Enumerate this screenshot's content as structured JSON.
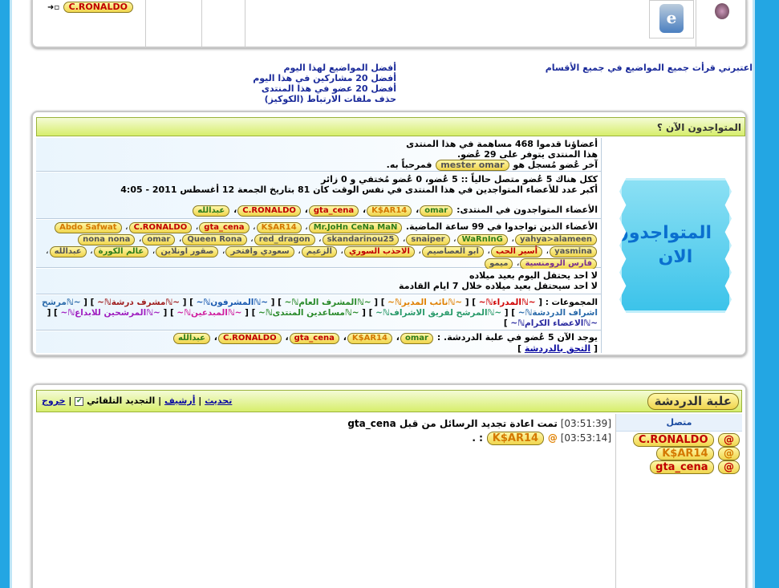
{
  "top": {
    "user_pill": "C.RONALDO"
  },
  "links": {
    "right": "اعتبرني قرأت جميع المواضيع في جميع الأقسام",
    "left": [
      "أفضل المواضيع لهذا اليوم",
      "أفضل 20 مشاركين في هذا اليوم",
      "أفضل 20 عضو في هذا المنتدى",
      "حذف ملفات الارتباط (الكوكيز)"
    ]
  },
  "online": {
    "header": "المتواجدون الآن ؟",
    "image_text": "المتواجدون الان",
    "stats": {
      "line1": "أعضاؤنا قدموا 468 مساهمة في هذا المنتدى",
      "line2": "هذا المنتدى يتوفر على 29 عُضو.",
      "line3_pre": "آخر عُضو مُسجل هو",
      "last_member": "mester omar",
      "line3_post": "فمرحباً به."
    },
    "presence": {
      "line1": "ككل هناك 5 عُضو متصل حالياً :: 5 عُضو، 0 عُضو مُختفي و 0 زائر",
      "line2": "أكبر عدد للأعضاء المتواجدين في هذا المنتدى في نفس الوقت كان 81 بتاريخ الجمعة 12 أغسطس 2011 - 4:05",
      "label": "الأعضاء المتواجدون في المنتدى:",
      "members": [
        "omar",
        "K$AR14",
        "gta_cena",
        "C.RONALDO",
        "عبدالله"
      ]
    },
    "last24": {
      "label": "الأعضاء الذين تواجدوا في 99 ساعة الماضية.",
      "members": [
        "Mr.JoHn CeNa MaN",
        "K$AR14",
        "gta_cena",
        "C.RONALDO",
        "Abdo Safwat",
        "yahya>alameen",
        "WaRnInG",
        "snaiper",
        "skandarinou25",
        "red_dragon",
        "Queen Rona",
        "omar",
        "nona nona",
        "yasmina",
        "أسير الحب",
        "ابو العصاصيم",
        "الاحذب السوري",
        "الزعيم",
        "سعودي وافتخر",
        "صقور اونلاين",
        "عالم الكورة",
        "عبدالله",
        "فارس الرومنسية",
        "ميمو"
      ]
    },
    "birthdays": {
      "today": "لا احد يحتفل اليوم بعيد ميلاده",
      "week": "لا احد سيحتفل بعيد ميلاده خلال 7 ايام القادمة"
    },
    "groups": {
      "label": "المجموعات :",
      "items": [
        "~ℕالمدراءℕ~",
        "~ℕنائب المديرℕ~",
        "~ℕالمشرف العامℕ~",
        "~ℕالمشرفونℕ~",
        "~ℕمشرف درشةℕ~",
        "~ℕمرشح اشراف الدردشةℕ~",
        "~ℕالمرشح لفريق الاشرافℕ~",
        "~ℕمساعدين المنتدىℕ~",
        "~ℕالمبدعينℕ~",
        "~ℕالمرشحين",
        "للابداعℕ~",
        "~ℕالاعضاء الكرامℕ~"
      ]
    },
    "chat": {
      "line": "يوجد الآن 5 عُضو في علبة الدردشة. :",
      "members": [
        "omar",
        "K$AR14",
        "gta_cena",
        "C.RONALDO",
        "عبدالله"
      ],
      "join": "التحق بالدردشة"
    }
  },
  "chatbox": {
    "title": "علبة الدردشة",
    "refresh": "تحديث",
    "archive": "أرشيف",
    "auto_refresh": "التجديد التلقائي",
    "logout": "خروج",
    "online_label": "متصل",
    "users": [
      "C.RONALDO",
      "K$AR14",
      "gta_cena"
    ],
    "messages": [
      {
        "time": "[03:51:39]",
        "text": "تمت اعادة تجديد الرسائل من قبل gta_cena"
      },
      {
        "time": "[03:53:14]",
        "at": "@",
        "user": "K$AR14",
        "text": ": ."
      }
    ]
  }
}
